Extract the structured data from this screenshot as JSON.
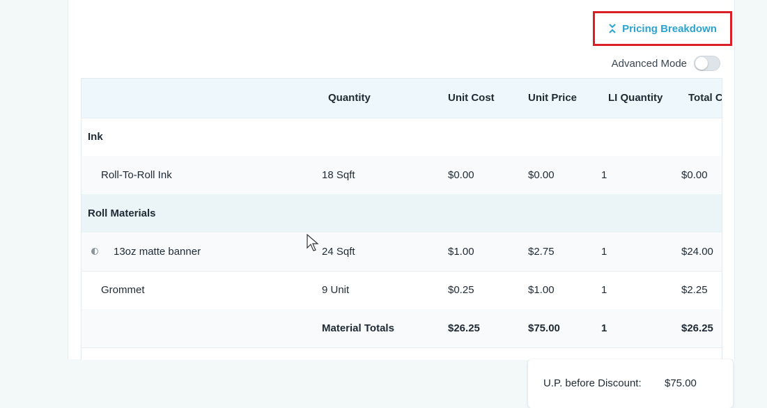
{
  "pricing_breakdown": {
    "label": "Pricing Breakdown",
    "icon": "collapse-chevrons-icon",
    "accent": "#2ba3cf",
    "highlight": "#dc1f26"
  },
  "advanced_mode": {
    "label": "Advanced Mode",
    "enabled": false
  },
  "table": {
    "headers": {
      "name": "",
      "quantity": "Quantity",
      "unit_cost": "Unit Cost",
      "unit_price": "Unit Price",
      "li_quantity": "LI Quantity",
      "total": "Total C"
    },
    "groups": {
      "ink": {
        "title": "Ink"
      },
      "roll": {
        "title": "Roll Materials"
      }
    },
    "rows": [
      {
        "name": "Roll-To-Roll Ink",
        "quantity": "18 Sqft",
        "unit_cost": "$0.00",
        "unit_price": "$0.00",
        "li_quantity": "1",
        "total": "$0.00"
      },
      {
        "name": "13oz matte banner",
        "quantity": "24 Sqft",
        "unit_cost": "$1.00",
        "unit_price": "$2.75",
        "li_quantity": "1",
        "total": "$24.00"
      },
      {
        "name": "Grommet",
        "quantity": "9 Unit",
        "unit_cost": "$0.25",
        "unit_price": "$1.00",
        "li_quantity": "1",
        "total": "$2.25"
      }
    ],
    "totals": {
      "label": "Material Totals",
      "unit_cost": "$26.25",
      "unit_price": "$75.00",
      "li_quantity": "1",
      "total": "$26.25"
    }
  },
  "summary": {
    "label": "U.P. before Discount:",
    "value": "$75.00"
  }
}
